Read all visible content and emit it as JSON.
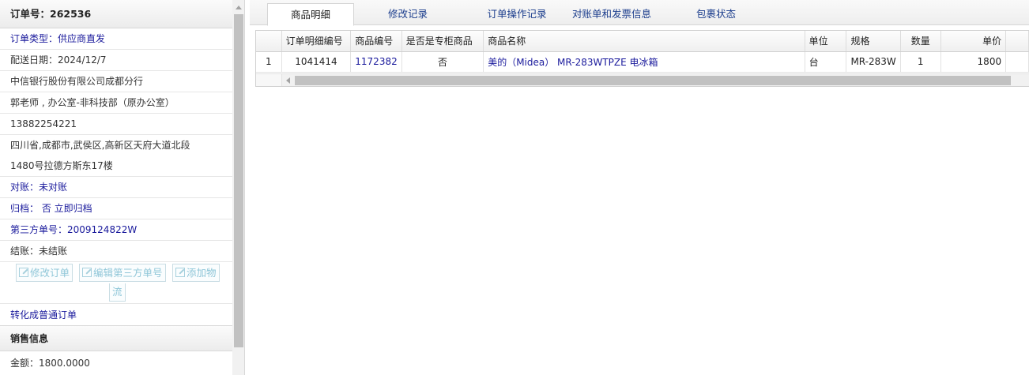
{
  "left_panel": {
    "order_header": "订单号：262536",
    "rows": [
      {
        "text": "订单类型：供应商直发",
        "style": "blue"
      },
      {
        "text": "配送日期：2024/12/7",
        "style": "normal"
      },
      {
        "text": "中信银行股份有限公司成都分行",
        "style": "normal"
      },
      {
        "text": "郭老师 , 办公室-非科技部（原办公室）",
        "style": "normal"
      },
      {
        "text": "13882254221",
        "style": "normal"
      }
    ],
    "address_line1": "四川省,成都市,武侯区,高新区天府大道北段",
    "address_line2": "1480号拉德方斯东17楼",
    "reconcile": "对账：未对账",
    "archive": "归档： 否 立即归档",
    "third_party_no": "第三方单号：2009124822W",
    "settle": "结账：未结账",
    "buttons": {
      "modify_order": "修改订单",
      "edit_third_party": "编辑第三方单号",
      "add_logistics_1": "添加物",
      "add_logistics_2": "流"
    },
    "convert_link": "转化成普通订单",
    "sales_header": "销售信息",
    "amount": "金额：1800.0000"
  },
  "tabs": [
    {
      "label": "商品明细",
      "active": true
    },
    {
      "label": "修改记录",
      "active": false
    },
    {
      "label": "订单操作记录",
      "active": false
    },
    {
      "label": "对账单和发票信息",
      "active": false
    },
    {
      "label": "包裹状态",
      "active": false
    }
  ],
  "grid": {
    "columns": [
      "",
      "订单明细编号",
      "商品编号",
      "是否是专柜商品",
      "商品名称",
      "单位",
      "规格",
      "数量",
      "单价"
    ],
    "row": {
      "index": "1",
      "detail_no": "1041414",
      "product_no": "1172382",
      "is_counter": "否",
      "name": "美的（Midea） MR-283WTPZE 电冰箱",
      "unit": "台",
      "spec": "MR-283W",
      "qty": "1",
      "price": "1800"
    }
  }
}
